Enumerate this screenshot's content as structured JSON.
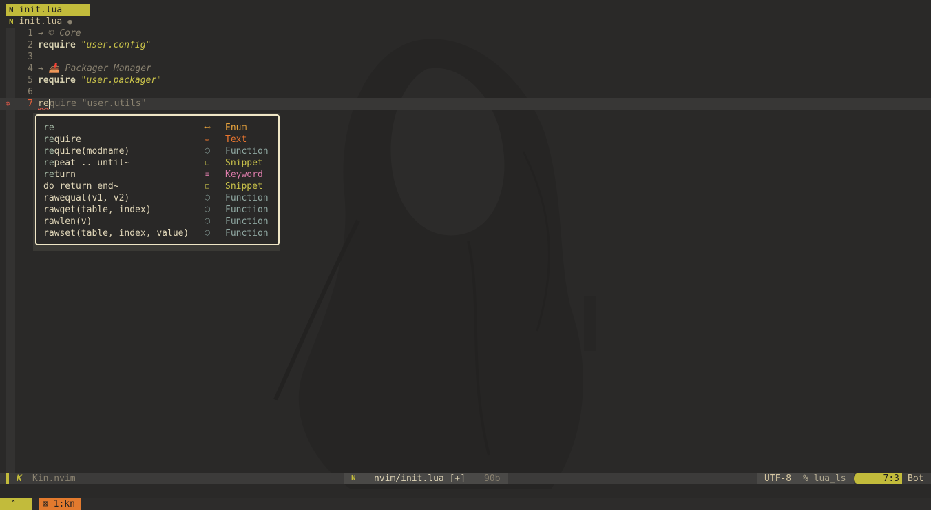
{
  "tabline": {
    "badge": "N",
    "title": "init.lua"
  },
  "winbar": {
    "badge": "N",
    "title": "init.lua",
    "modified": "●"
  },
  "lines": [
    {
      "num": "1",
      "text": "→ © Core"
    },
    {
      "num": "2",
      "kw": "require",
      "str": "\"user.config\""
    },
    {
      "num": "3"
    },
    {
      "num": "4",
      "text": "→ 📥 Packager Manager"
    },
    {
      "num": "5",
      "kw": "require",
      "str": "\"user.packager\""
    },
    {
      "num": "6"
    },
    {
      "num": "7",
      "typed": "re",
      "ghost": "quire \"user.utils\"",
      "sign": "⊗"
    }
  ],
  "completion": {
    "items": [
      {
        "match": "re",
        "rest": "",
        "kind": "Enum",
        "icon": "⊷",
        "color": "#e6a23c"
      },
      {
        "match": "re",
        "rest": "quire",
        "kind": "Text",
        "icon": "✏",
        "color": "#e8752f"
      },
      {
        "match": "re",
        "rest": "quire(modname)",
        "kind": "Function",
        "icon": "⬡",
        "color": "#8ea6a0"
      },
      {
        "match": "re",
        "rest": "peat .. until~",
        "kind": "Snippet",
        "icon": "□",
        "color": "#c9c24a"
      },
      {
        "match": "re",
        "rest": "turn",
        "kind": "Keyword",
        "icon": "≡",
        "color": "#d97aa8"
      },
      {
        "match": "",
        "rest": "do return end~",
        "kind": "Snippet",
        "icon": "□",
        "color": "#c9c24a"
      },
      {
        "match": "",
        "rest": "rawequal(v1, v2)",
        "kind": "Function",
        "icon": "⬡",
        "color": "#8ea6a0"
      },
      {
        "match": "",
        "rest": "rawget(table, index)",
        "kind": "Function",
        "icon": "⬡",
        "color": "#8ea6a0"
      },
      {
        "match": "",
        "rest": "rawlen(v)",
        "kind": "Function",
        "icon": "⬡",
        "color": "#8ea6a0"
      },
      {
        "match": "",
        "rest": "rawset(table, index, value)",
        "kind": "Function",
        "icon": "⬡",
        "color": "#8ea6a0"
      }
    ]
  },
  "statusline": {
    "mode_icon": "K",
    "name": "Kin.nvim",
    "file_badge": "N",
    "file": "nvim/init.lua [+]",
    "size": "90b",
    "encoding": "UTF-8",
    "lsp": "% lua_ls",
    "position": "7:3",
    "scroll": "Bot"
  },
  "tmux": {
    "session_icon": "^",
    "window": "⊠ 1:kn"
  }
}
